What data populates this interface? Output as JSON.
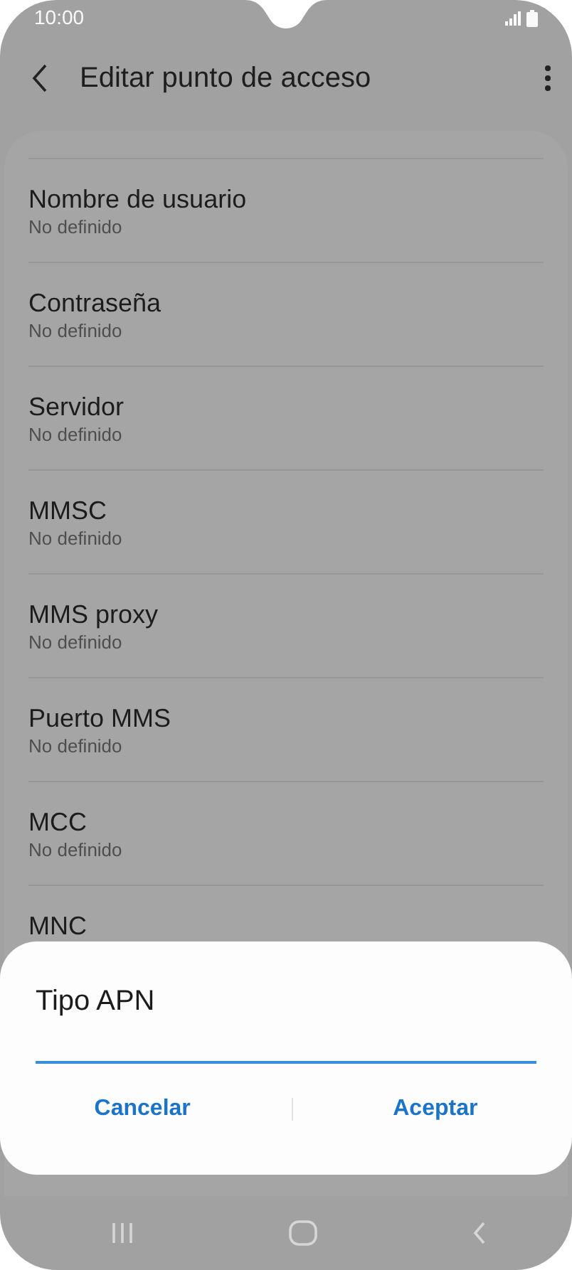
{
  "status_bar": {
    "time": "10:00"
  },
  "toolbar": {
    "title": "Editar punto de acceso"
  },
  "settings": [
    {
      "label": "Nombre de usuario",
      "value": "No definido"
    },
    {
      "label": "Contraseña",
      "value": "No definido"
    },
    {
      "label": "Servidor",
      "value": "No definido"
    },
    {
      "label": "MMSC",
      "value": "No definido"
    },
    {
      "label": "MMS proxy",
      "value": "No definido"
    },
    {
      "label": "Puerto MMS",
      "value": "No definido"
    },
    {
      "label": "MCC",
      "value": "No definido"
    },
    {
      "label": "MNC"
    }
  ],
  "dialog": {
    "title": "Tipo APN",
    "field": {
      "focused": true
    },
    "buttons": [
      "Cancelar",
      "Aceptar"
    ]
  }
}
